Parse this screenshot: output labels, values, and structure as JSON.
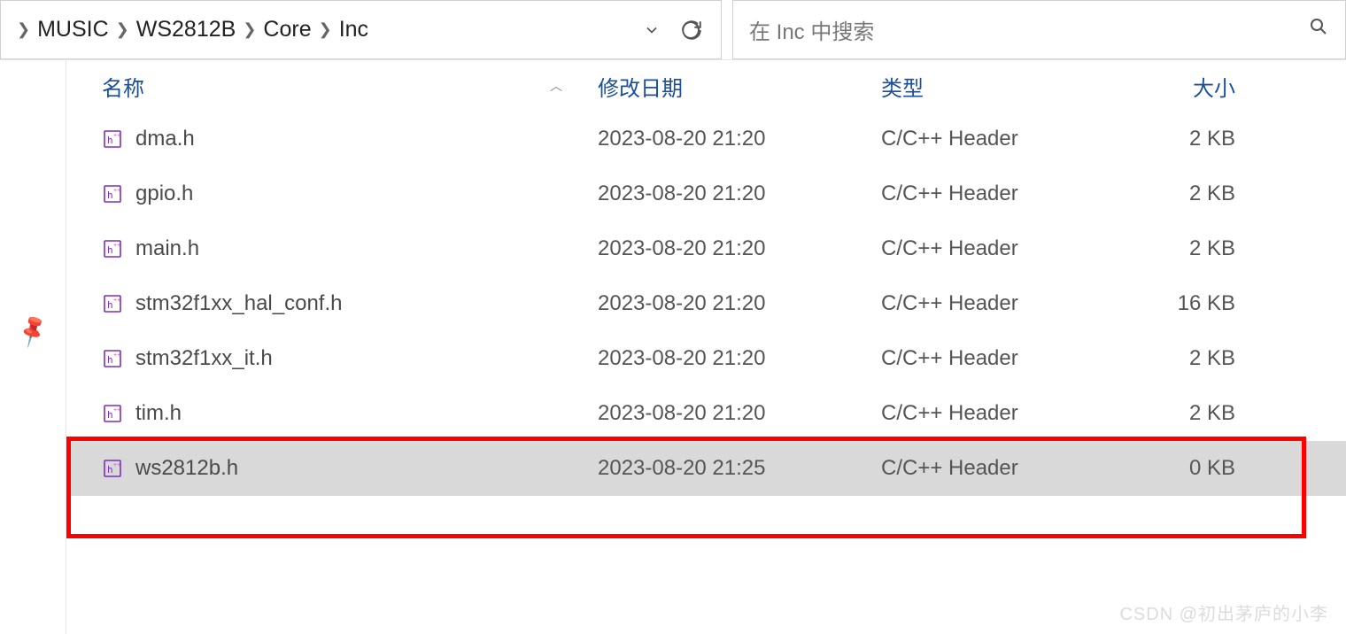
{
  "breadcrumb": [
    "MUSIC",
    "WS2812B",
    "Core",
    "Inc"
  ],
  "search": {
    "placeholder": "在 Inc 中搜索"
  },
  "columns": {
    "name": "名称",
    "date": "修改日期",
    "type": "类型",
    "size": "大小"
  },
  "files": [
    {
      "name": "dma.h",
      "date": "2023-08-20 21:20",
      "type": "C/C++ Header",
      "size": "2 KB",
      "selected": false
    },
    {
      "name": "gpio.h",
      "date": "2023-08-20 21:20",
      "type": "C/C++ Header",
      "size": "2 KB",
      "selected": false
    },
    {
      "name": "main.h",
      "date": "2023-08-20 21:20",
      "type": "C/C++ Header",
      "size": "2 KB",
      "selected": false
    },
    {
      "name": "stm32f1xx_hal_conf.h",
      "date": "2023-08-20 21:20",
      "type": "C/C++ Header",
      "size": "16 KB",
      "selected": false
    },
    {
      "name": "stm32f1xx_it.h",
      "date": "2023-08-20 21:20",
      "type": "C/C++ Header",
      "size": "2 KB",
      "selected": false
    },
    {
      "name": "tim.h",
      "date": "2023-08-20 21:20",
      "type": "C/C++ Header",
      "size": "2 KB",
      "selected": false
    },
    {
      "name": "ws2812b.h",
      "date": "2023-08-20 21:25",
      "type": "C/C++ Header",
      "size": "0 KB",
      "selected": true
    }
  ],
  "watermark": "CSDN @初出茅庐的小李"
}
